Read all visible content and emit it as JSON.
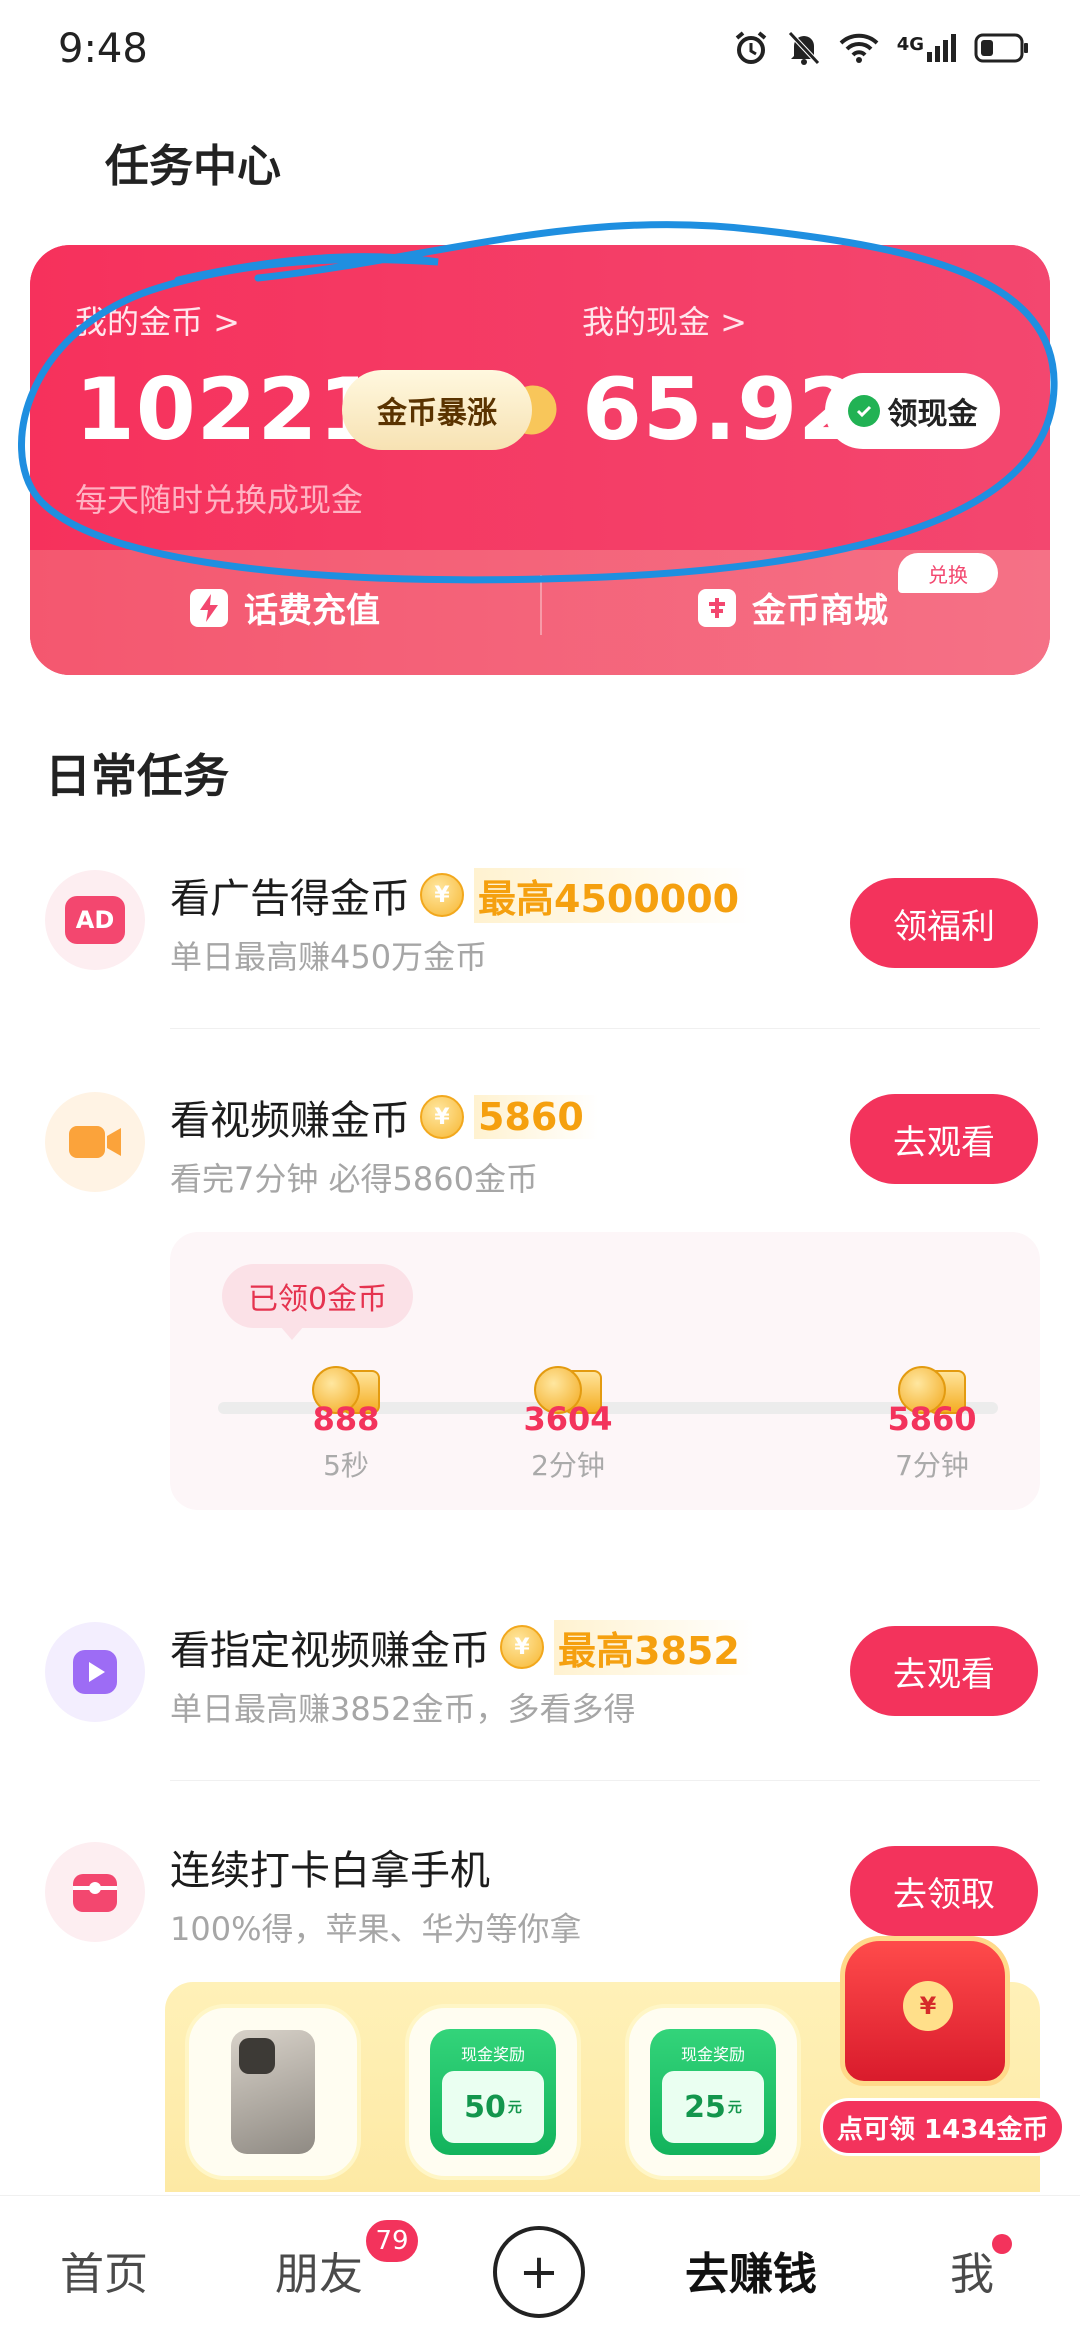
{
  "status_bar": {
    "time": "9:48",
    "icons": [
      "alarm-icon",
      "mute-icon",
      "wifi-icon",
      "signal-4g-icon",
      "battery-icon"
    ],
    "network_label": "4G"
  },
  "page_title": "任务中心",
  "wallet": {
    "coins_label": "我的金币 >",
    "coins_value": "10221",
    "coins_badge": "金币暴涨",
    "cash_label": "我的现金 >",
    "cash_value": "65.92",
    "cash_button": "领现金",
    "subtitle": "每天随时兑换成现金",
    "actions": [
      {
        "label": "话费充值",
        "icon": "lightning-icon"
      },
      {
        "label": "金币商城",
        "icon": "store-icon"
      }
    ],
    "tag": "兑换",
    "colors": {
      "card": "#f3476f",
      "accent": "#f3335c"
    }
  },
  "section_title": "日常任务",
  "tasks": [
    {
      "title": "看广告得金币",
      "icon_text": "AD",
      "reward": "最高4500000",
      "desc": "单日最高赚450万金币",
      "button": "领福利"
    },
    {
      "title": "看视频赚金币",
      "reward": "5860",
      "desc": "看完7分钟 必得5860金币",
      "button": "去观看"
    },
    {
      "title": "看指定视频赚金币",
      "reward": "最高3852",
      "desc": "单日最高赚3852金币，多看多得",
      "button": "去观看"
    },
    {
      "title": "连续打卡白拿手机",
      "desc": "100%得，苹果、华为等你拿",
      "button": "去领取"
    }
  ],
  "progress": {
    "claimed": "已领0金币",
    "milestones": [
      {
        "value": "888",
        "label": "5秒"
      },
      {
        "value": "3604",
        "label": "2分钟"
      },
      {
        "value": "5860",
        "label": "7分钟"
      }
    ]
  },
  "checkin_rewards": {
    "ticket_title": "现金奖励",
    "tickets": [
      {
        "amount": "50",
        "unit": "元"
      },
      {
        "amount": "25",
        "unit": "元"
      }
    ],
    "claim_text": "点可领 1434金币"
  },
  "bottom_nav": {
    "items": [
      "首页",
      "朋友",
      "去赚钱",
      "我"
    ],
    "friends_badge": "79",
    "active": "去赚钱",
    "plus_symbol": "+"
  }
}
